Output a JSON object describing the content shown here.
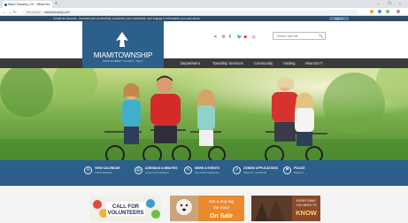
{
  "browser": {
    "tab_title": "Miami Township, OH - Official W...",
    "tab_close": "×",
    "new_tab": "+",
    "window_controls": "– ❐ ×",
    "back": "←",
    "forward": "→",
    "reload": "↻",
    "home": "⌂",
    "security_label": "Not secure",
    "url": "miamitownship.com"
  },
  "notice": {
    "text": "Create an Account - Increase your productivity, customize your experience, and engage in information you care about.",
    "sign_in": "Sign In"
  },
  "header": {
    "logo_name": "MIAMI",
    "logo_name2": "TOWNSHIP",
    "logo_sub": "MONTGOMERY COUNTY, OHIO",
    "social": [
      {
        "icon": "share-icon",
        "glyph": "<",
        "color": "#555555"
      },
      {
        "icon": "settings-icon",
        "glyph": "⚙",
        "color": "#555555"
      },
      {
        "icon": "facebook-icon",
        "glyph": "f",
        "color": "#3b5998"
      },
      {
        "icon": "twitter-icon",
        "glyph": "🐦",
        "color": "#1da1f2"
      },
      {
        "icon": "youtube-icon",
        "glyph": "▶",
        "color": "#e62117"
      },
      {
        "icon": "instagram-icon",
        "glyph": "◎",
        "color": "#c13584"
      }
    ],
    "search_placeholder": "Search this site",
    "search_icon": "🔍"
  },
  "nav": {
    "items": [
      "Department",
      "Township Services",
      "Community",
      "Visiting",
      "How Do I?"
    ]
  },
  "quick_links": [
    {
      "icon": "calendar-icon",
      "glyph": "⊙",
      "title": "VIEW CALENDAR",
      "subtitle": "Public Meetings"
    },
    {
      "icon": "agenda-icon",
      "glyph": "▤",
      "title": "AGENDAS & MINUTES",
      "subtitle": "Upcoming & Archived"
    },
    {
      "icon": "news-icon",
      "glyph": "✎",
      "title": "NEWS & EVENTS",
      "subtitle": "See what's happening"
    },
    {
      "icon": "zoning-icon",
      "glyph": "➚",
      "title": "ZONING APPLICATIONS",
      "subtitle": "Apply for a certificate"
    },
    {
      "icon": "police-icon",
      "glyph": "⚑",
      "title": "POLICE",
      "subtitle": "Report It"
    }
  ],
  "promos": [
    {
      "line1": "CALL FOR",
      "line2": "VOLUNTEERS"
    },
    {
      "line1": "Get a dog tag",
      "line2": "the mind",
      "line3": "On Sale"
    },
    {
      "line1": "EVERYTHING",
      "line2": "YOU NEED TO",
      "line3": "KNOW"
    }
  ],
  "colors": {
    "brand_blue": "#2c5f8a",
    "notice_bar": "#2f4c65",
    "nav_bar": "#3a3a3a",
    "quick_bar": "#2c5f8a"
  }
}
